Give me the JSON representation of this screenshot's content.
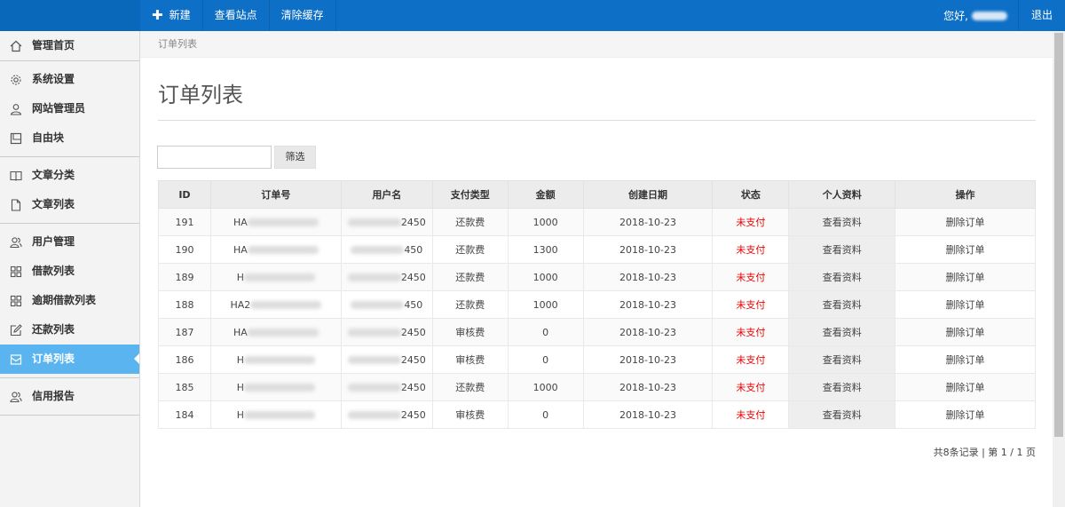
{
  "topnav": {
    "new_label": "新建",
    "view_site_label": "查看站点",
    "clear_cache_label": "清除缓存",
    "greeting": "您好,",
    "logout_label": "退出"
  },
  "sidebar": {
    "groups": [
      [
        {
          "label": "管理首页",
          "icon": "home-icon"
        }
      ],
      [
        {
          "label": "系统设置",
          "icon": "gear-icon"
        },
        {
          "label": "网站管理员",
          "icon": "user-icon"
        },
        {
          "label": "自由块",
          "icon": "block-icon"
        }
      ],
      [
        {
          "label": "文章分类",
          "icon": "book-icon"
        },
        {
          "label": "文章列表",
          "icon": "document-icon"
        }
      ],
      [
        {
          "label": "用户管理",
          "icon": "users-icon"
        },
        {
          "label": "借款列表",
          "icon": "grid-icon"
        },
        {
          "label": "逾期借款列表",
          "icon": "grid-icon"
        },
        {
          "label": "还款列表",
          "icon": "edit-icon"
        },
        {
          "label": "订单列表",
          "icon": "inbox-icon",
          "active": true
        }
      ],
      [
        {
          "label": "信用报告",
          "icon": "users-icon"
        }
      ]
    ]
  },
  "breadcrumb": "订单列表",
  "page_title": "订单列表",
  "filter": {
    "input_value": "",
    "button_label": "筛选"
  },
  "table": {
    "headers": [
      "ID",
      "订单号",
      "用户名",
      "支付类型",
      "金额",
      "创建日期",
      "状态",
      "个人资料",
      "操作"
    ],
    "rows": [
      {
        "id": "191",
        "order_prefix": "HA",
        "user_suffix": "2450",
        "pay_type": "还款费",
        "amount": "1000",
        "date": "2018-10-23",
        "status": "未支付",
        "profile": "查看资料",
        "action": "删除订单"
      },
      {
        "id": "190",
        "order_prefix": "HA",
        "user_suffix": "450",
        "pay_type": "还款费",
        "amount": "1300",
        "date": "2018-10-23",
        "status": "未支付",
        "profile": "查看资料",
        "action": "删除订单"
      },
      {
        "id": "189",
        "order_prefix": "H",
        "user_suffix": "2450",
        "pay_type": "还款费",
        "amount": "1000",
        "date": "2018-10-23",
        "status": "未支付",
        "profile": "查看资料",
        "action": "删除订单"
      },
      {
        "id": "188",
        "order_prefix": "HA2",
        "user_suffix": "450",
        "pay_type": "还款费",
        "amount": "1000",
        "date": "2018-10-23",
        "status": "未支付",
        "profile": "查看资料",
        "action": "删除订单"
      },
      {
        "id": "187",
        "order_prefix": "HA",
        "user_suffix": "2450",
        "pay_type": "审核费",
        "amount": "0",
        "date": "2018-10-23",
        "status": "未支付",
        "profile": "查看资料",
        "action": "删除订单"
      },
      {
        "id": "186",
        "order_prefix": "H",
        "user_suffix": "2450",
        "pay_type": "审核费",
        "amount": "0",
        "date": "2018-10-23",
        "status": "未支付",
        "profile": "查看资料",
        "action": "删除订单"
      },
      {
        "id": "185",
        "order_prefix": "H",
        "user_suffix": "2450",
        "pay_type": "还款费",
        "amount": "1000",
        "date": "2018-10-23",
        "status": "未支付",
        "profile": "查看资料",
        "action": "删除订单"
      },
      {
        "id": "184",
        "order_prefix": "H",
        "user_suffix": "2450",
        "pay_type": "审核费",
        "amount": "0",
        "date": "2018-10-23",
        "status": "未支付",
        "profile": "查看资料",
        "action": "删除订单"
      }
    ]
  },
  "pager": "共8条记录 | 第 1 / 1 页",
  "colors": {
    "topbar": "#0d6fc5",
    "active_item": "#5ab4f0",
    "status_unpaid": "#e00000"
  }
}
